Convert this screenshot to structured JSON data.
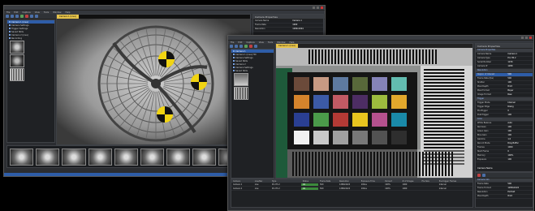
{
  "left_window": {
    "title": "",
    "menu": [
      "File",
      "Edit",
      "Capture",
      "View",
      "Tools",
      "Window",
      "Help"
    ],
    "view_tab": "Camera 1 (Live)",
    "tree": [
      {
        "label": "Camera 1 (Live)",
        "selected": true
      },
      {
        "label": "Camera Settings",
        "selected": false
      },
      {
        "label": "Trigger Settings",
        "selected": false
      },
      {
        "label": "Saved Stills",
        "selected": false
      },
      {
        "label": "Camera 2 (Live)",
        "selected": false
      },
      {
        "label": "Recording",
        "selected": false
      }
    ],
    "props_title": "Camera Properties",
    "props": [
      {
        "k": "Camera Name",
        "v": "Camera 1"
      },
      {
        "k": "Frame Rate",
        "v": "1000"
      },
      {
        "k": "Resolution",
        "v": "1280x1024"
      }
    ],
    "filmstrip_labels": [
      "",
      "",
      "",
      "",
      "",
      "",
      "",
      "",
      "",
      "",
      "",
      ""
    ],
    "status": [
      "",
      "",
      ""
    ]
  },
  "right_window": {
    "title": "",
    "menu": [
      "File",
      "Edit",
      "Capture",
      "View",
      "Tools",
      "Window",
      "Help"
    ],
    "view_tab": "Camera 1 (Live)",
    "tree": [
      {
        "label": "Camera 1",
        "selected": true
      },
      {
        "label": "Camera 1 (Live) HD",
        "selected": false
      },
      {
        "label": "Camera Settings",
        "selected": false
      },
      {
        "label": "Saved Stills",
        "selected": false
      },
      {
        "label": "Camera 2",
        "selected": false
      },
      {
        "label": "Camera Settings",
        "selected": false
      },
      {
        "label": "Saved Stills",
        "selected": false
      }
    ],
    "props_title": "Camera Properties",
    "props": [
      {
        "k": "Camera Properties",
        "v": "",
        "grp": true
      },
      {
        "k": "Camera Name",
        "v": "Camera 1"
      },
      {
        "k": "Camera Type",
        "v": "Pro HS 2"
      },
      {
        "k": "Serial Number",
        "v": "1234"
      },
      {
        "k": "Camera IP",
        "v": "1280"
      },
      {
        "k": "Resolution",
        "v": "",
        "grp": true
      },
      {
        "k": "Region of Interest",
        "v": "500",
        "sel": true
      },
      {
        "k": "Frame Rate (fps)",
        "v": "500"
      },
      {
        "k": "Shutter",
        "v": "100"
      },
      {
        "k": "Pixel Depth",
        "v": "8 bit"
      },
      {
        "k": "Pixel Format",
        "v": "Bayer"
      },
      {
        "k": "Image Format",
        "v": "Raw"
      },
      {
        "k": "Trigger",
        "v": "",
        "grp": true
      },
      {
        "k": "Trigger Mode",
        "v": "Internal"
      },
      {
        "k": "Trigger Edge",
        "v": "Rising"
      },
      {
        "k": "Pre-Trigger",
        "v": "0"
      },
      {
        "k": "Post-Trigger",
        "v": "100"
      },
      {
        "k": "Color",
        "v": "",
        "grp": true
      },
      {
        "k": "White Balance",
        "v": "Auto"
      },
      {
        "k": "Red Gain",
        "v": "100"
      },
      {
        "k": "Green Gain",
        "v": "100"
      },
      {
        "k": "Blue Gain",
        "v": "100"
      },
      {
        "k": "Gamma",
        "v": "1.0"
      },
      {
        "k": "Record Mode",
        "v": "Ring Buffer"
      },
      {
        "k": "Frames",
        "v": "1000"
      },
      {
        "k": "Start Frame",
        "v": "0"
      },
      {
        "k": "Memory",
        "v": "100%"
      },
      {
        "k": "Exposure",
        "v": "100"
      }
    ],
    "props_desc": "Camera Name",
    "grid": {
      "headers": [
        "Camera",
        "Live/Rec",
        "Type",
        "Status",
        "Frame Rate",
        "Resolution",
        "Exposure Time",
        "Percent",
        "# of Images",
        "File Size",
        "Pre-trigger Frames"
      ],
      "rows": [
        [
          "Camera 1",
          "Live",
          "Pro HS 2",
          "OK",
          "500",
          "1280x1024",
          "100us",
          "100%",
          "1000",
          "",
          "Internal"
        ],
        [
          "Camera 2",
          "Live",
          "Pro HS 2",
          "OK",
          "500",
          "1280x1024",
          "100us",
          "100%",
          "1000",
          "",
          "Internal"
        ]
      ]
    },
    "lower_props": [
      {
        "k": "Camera Info",
        "v": "",
        "grp": true
      },
      {
        "k": "Frame Rate",
        "v": "500"
      },
      {
        "k": "Frame Format",
        "v": "1280x1024"
      },
      {
        "k": "Resolution",
        "v": "Portrait"
      },
      {
        "k": "Pixel Depth",
        "v": "8 bit"
      }
    ]
  },
  "colors": {
    "accent": "#2e5da8",
    "tab": "#e6c34a",
    "window_bg": "#2b2d31",
    "target_yellow": "#f1d412"
  },
  "chart_swatches": [
    "#6b4a3a",
    "#c79a83",
    "#5e7aa0",
    "#58683a",
    "#8583b8",
    "#62bcb0",
    "#d5842c",
    "#3c5aa6",
    "#c25a64",
    "#4d2d63",
    "#9dbb3e",
    "#e2a82c",
    "#2a3f92",
    "#4b9a4a",
    "#b33a35",
    "#e8c51f",
    "#b5518e",
    "#1a8aa9",
    "#f2f2f2",
    "#c9c9c9",
    "#a0a0a0",
    "#787878",
    "#525252",
    "#2e2e2e"
  ]
}
